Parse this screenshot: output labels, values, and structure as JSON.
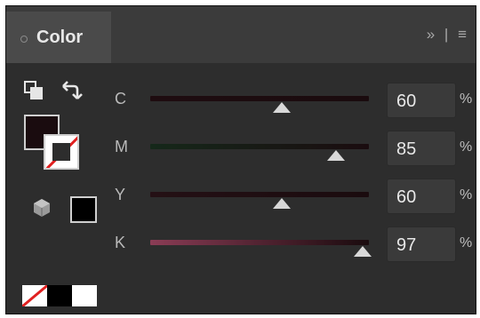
{
  "panel": {
    "title": "Color",
    "menu_chevron": "»",
    "menu_divider": "|",
    "menu_icon": "≡"
  },
  "sliders": [
    {
      "label": "C",
      "value": "60",
      "unit": "%",
      "fraction": 0.6,
      "track": "linear-gradient(90deg,#1e0c10,#1a0b0e)"
    },
    {
      "label": "M",
      "value": "85",
      "unit": "%",
      "fraction": 0.85,
      "track": "linear-gradient(90deg,#15281a,#1a0c0f)"
    },
    {
      "label": "Y",
      "value": "60",
      "unit": "%",
      "fraction": 0.6,
      "track": "linear-gradient(90deg,#241015,#1a0b0e)"
    },
    {
      "label": "K",
      "value": "97",
      "unit": "%",
      "fraction": 0.97,
      "track": "linear-gradient(90deg,#8a3c55,#1a0b0e)"
    }
  ],
  "colors": {
    "fill": "#1a0c0f",
    "panel_bg": "#2d2d2d",
    "header_bg": "#3b3b3b"
  },
  "icons": {
    "swap_fill_stroke": "default-fill-stroke-icon",
    "swap_arrow": "swap-arrow-icon",
    "gamut": "out-of-gamut-cube-icon"
  }
}
